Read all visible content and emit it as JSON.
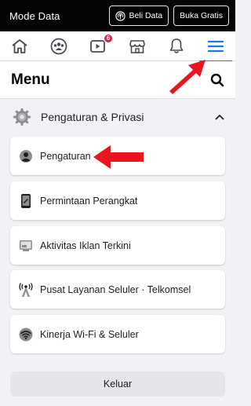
{
  "databar": {
    "mode_label": "Mode Data",
    "buy_data_label": "Beli Data",
    "open_free_label": "Buka Gratis"
  },
  "nav": {
    "items": [
      {
        "icon": "home-icon"
      },
      {
        "icon": "groups-icon"
      },
      {
        "icon": "video-icon",
        "badge": "6"
      },
      {
        "icon": "marketplace-icon"
      },
      {
        "icon": "bell-icon"
      },
      {
        "icon": "menu-icon",
        "active": true
      }
    ],
    "active_color": "#1877f2",
    "badge_color": "#e41e3f"
  },
  "menu": {
    "title": "Menu"
  },
  "section": {
    "label": "Pengaturan & Privasi"
  },
  "items": [
    {
      "label": "Pengaturan",
      "icon": "profile-settings-icon"
    },
    {
      "label": "Permintaan Perangkat",
      "icon": "device-icon"
    },
    {
      "label": "Aktivitas Iklan Terkini",
      "icon": "ad-activity-icon"
    },
    {
      "label": "Pusat Layanan Seluler · Telkomsel",
      "icon": "cell-tower-icon"
    },
    {
      "label": "Kinerja Wi-Fi & Seluler",
      "icon": "wifi-icon"
    }
  ],
  "logout": {
    "label": "Keluar"
  },
  "annotation_color": "#e8141e"
}
